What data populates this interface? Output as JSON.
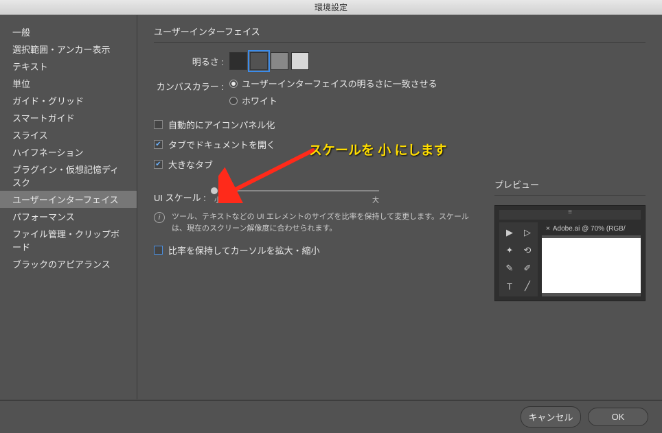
{
  "titlebar": "環境設定",
  "sidebar": {
    "items": [
      "一般",
      "選択範囲・アンカー表示",
      "テキスト",
      "単位",
      "ガイド・グリッド",
      "スマートガイド",
      "スライス",
      "ハイフネーション",
      "プラグイン・仮想記憶ディスク",
      "ユーザーインターフェイス",
      "パフォーマンス",
      "ファイル管理・クリップボード",
      "ブラックのアピアランス"
    ],
    "selected_index": 9
  },
  "content": {
    "section_title": "ユーザーインターフェイス",
    "brightness": {
      "label": "明るさ :",
      "swatches": [
        "#2e2e2e",
        "#525252",
        "#888888",
        "#d8d8d8"
      ],
      "selected_index": 1
    },
    "canvas_color": {
      "label": "カンバスカラー :",
      "options": [
        "ユーザーインターフェイスの明るさに一致させる",
        "ホワイト"
      ],
      "selected_index": 0
    },
    "checkboxes": {
      "auto_icon_panel": {
        "label": "自動的にアイコンパネル化",
        "checked": false
      },
      "open_in_tabs": {
        "label": "タブでドキュメントを開く",
        "checked": true
      },
      "large_tabs": {
        "label": "大きなタブ",
        "checked": true
      }
    },
    "ui_scale": {
      "label": "UI スケール :",
      "min_label": "小",
      "max_label": "大",
      "value": 0
    },
    "info_text": "ツール、テキストなどの UI エレメントのサイズを比率を保持して変更します。スケールは、現在のスクリーン解像度に合わせられます。",
    "cursor_scale": {
      "label": "比率を保持してカーソルを拡大・縮小",
      "checked": false
    },
    "preview": {
      "title": "プレビュー",
      "doc_tab": {
        "close": "×",
        "label": "Adobe.ai @ 70% (RGB/"
      }
    }
  },
  "footer": {
    "cancel": "キャンセル",
    "ok": "OK"
  },
  "annotation": "スケールを 小 にします"
}
